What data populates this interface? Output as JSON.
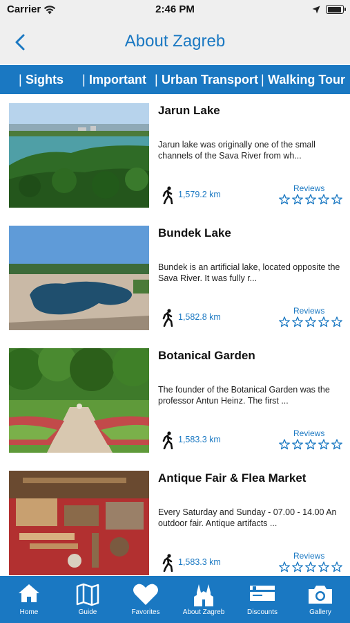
{
  "status": {
    "carrier": "Carrier",
    "time": "2:46 PM"
  },
  "header": {
    "title": "About Zagreb"
  },
  "tabs": [
    {
      "label": "Sights"
    },
    {
      "label": "Important"
    },
    {
      "label": "Urban Transport"
    },
    {
      "label": "Walking Tour"
    }
  ],
  "places": [
    {
      "title": "Jarun Lake",
      "description": "Jarun lake was originally one of the small channels of the Sava River from wh...",
      "distance": "1,579.2 km",
      "reviews_label": "Reviews",
      "rating": 0
    },
    {
      "title": "Bundek Lake",
      "description": "Bundek is an artificial lake, located opposite the Sava River. It was fully r...",
      "distance": "1,582.8 km",
      "reviews_label": "Reviews",
      "rating": 0
    },
    {
      "title": "Botanical Garden",
      "description": "The founder of the Botanical Garden was the professor Antun Heinz. The first ...",
      "distance": "1,583.3 km",
      "reviews_label": "Reviews",
      "rating": 0
    },
    {
      "title": "Antique Fair & Flea Market",
      "description": "Every Saturday and Sunday - 07.00 - 14.00 An outdoor fair. Antique artifacts ...",
      "distance": "1,583.3 km",
      "reviews_label": "Reviews",
      "rating": 0
    }
  ],
  "bottom_nav": [
    {
      "label": "Home",
      "icon": "home-icon"
    },
    {
      "label": "Guide",
      "icon": "map-icon"
    },
    {
      "label": "Favorites",
      "icon": "heart-icon"
    },
    {
      "label": "About Zagreb",
      "icon": "cathedral-icon"
    },
    {
      "label": "Discounts",
      "icon": "discount-card-icon"
    },
    {
      "label": "Gallery",
      "icon": "camera-icon"
    }
  ],
  "colors": {
    "accent": "#1a78c2",
    "bar_background": "#efefef"
  }
}
